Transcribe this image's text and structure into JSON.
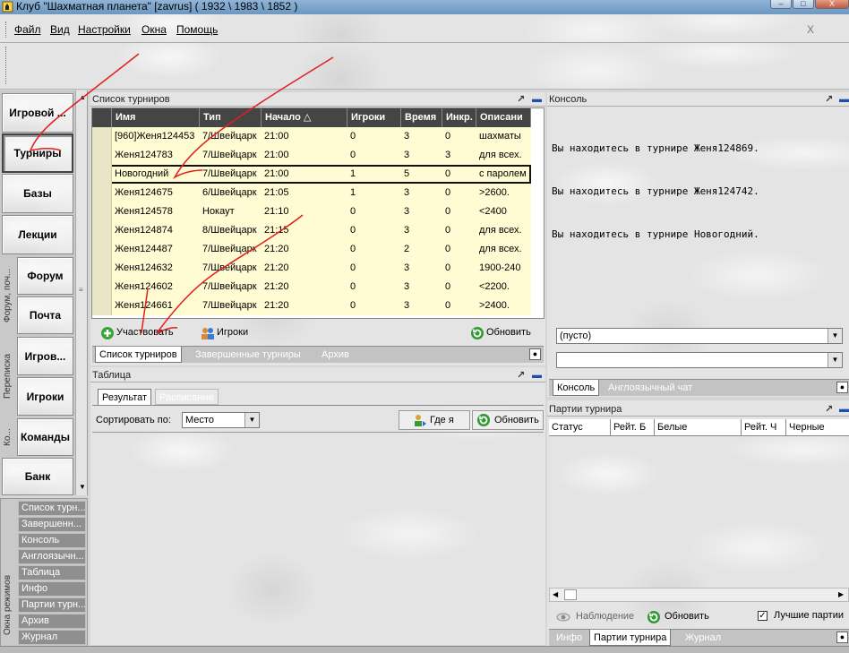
{
  "window": {
    "title": "Клуб \"Шахматная планета\" [zavrus]  ( 1932 \\ 1983 \\ 1852 )",
    "min": "–",
    "max": "□",
    "close": "X"
  },
  "menu": {
    "items": [
      "Файл",
      "Вид",
      "Настройки",
      "Окна",
      "Помощь"
    ],
    "close": "X"
  },
  "nav": {
    "buttons": [
      "Игровой ...",
      "Турниры",
      "Базы",
      "Лекции",
      "Форум",
      "Почта",
      "Игров...",
      "Игроки",
      "Команды",
      "Банк"
    ],
    "groups": [
      "Форум, поч...",
      "Переписка",
      "Ко..."
    ],
    "active": "Турниры"
  },
  "modes": {
    "title": "Окна режимов",
    "items": [
      "Список турн...",
      "Завершенн...",
      "Консоль",
      "Англоязычн...",
      "Таблица",
      "Инфо",
      "Партии турн...",
      "Архив",
      "Журнал"
    ]
  },
  "tournaments": {
    "title": "Список турниров",
    "columns": [
      "Имя",
      "Тип",
      "Начало",
      "Игроки",
      "Время",
      "Инкр.",
      "Описани"
    ],
    "sort_mark": "△",
    "rows": [
      [
        "[960]Женя124453",
        "7/Швейцарк",
        "21:00",
        "0",
        "3",
        "0",
        "шахматы"
      ],
      [
        "Женя124783",
        "7/Швейцарк",
        "21:00",
        "0",
        "3",
        "3",
        "для всех."
      ],
      [
        "Новогодний",
        "7/Швейцарк",
        "21:00",
        "1",
        "5",
        "0",
        "с паролем"
      ],
      [
        "Женя124675",
        "6/Швейцарк",
        "21:05",
        "1",
        "3",
        "0",
        ">2600."
      ],
      [
        "Женя124578",
        "Нокаут",
        "21:10",
        "0",
        "3",
        "0",
        "<2400"
      ],
      [
        "Женя124874",
        "8/Швейцарк",
        "21:15",
        "0",
        "3",
        "0",
        "для всех."
      ],
      [
        "Женя124487",
        "7/Швейцарк",
        "21:20",
        "0",
        "2",
        "0",
        "для всех."
      ],
      [
        "Женя124632",
        "7/Швейцарк",
        "21:20",
        "0",
        "3",
        "0",
        "1900-240"
      ],
      [
        "Женя124602",
        "7/Швейцарк",
        "21:20",
        "0",
        "3",
        "0",
        "<2200."
      ],
      [
        "Женя124661",
        "7/Швейцарк",
        "21:20",
        "0",
        "3",
        "0",
        ">2400."
      ]
    ],
    "selected_index": 2,
    "join_label": "Участвовать",
    "players_label": "Игроки",
    "refresh_label": "Обновить",
    "tabs": [
      "Список турниров",
      "Завершенные турниры",
      "Архив"
    ]
  },
  "table_panel": {
    "title": "Таблица",
    "subtabs": [
      "Результат",
      "Расписание"
    ],
    "sort_label": "Сортировать по:",
    "sort_value": "Место",
    "where_label": "Где я",
    "refresh_label": "Обновить"
  },
  "console": {
    "title": "Консоль",
    "lines": [
      "Вы находитесь в турнире Женя124869.",
      "Вы находитесь в турнире Женя124742.",
      "Вы находитесь в турнире Новогодний."
    ],
    "select1": "(пусто)",
    "select2": "",
    "tabs": [
      "Консоль",
      "Англоязычный чат"
    ]
  },
  "games": {
    "title": "Партии турнира",
    "columns": [
      "Статус",
      "Рейт. Б",
      "Белые",
      "Рейт. Ч",
      "Черные"
    ],
    "watch_label": "Наблюдение",
    "refresh_label": "Обновить",
    "best_label": "Лучшие партии",
    "best_checked": "✓",
    "tabs": [
      "Инфо",
      "Партии турнира",
      "Журнал"
    ]
  },
  "colors": {
    "row_bg": "#fffbd3",
    "header_bg": "#454545",
    "annotation": "#e0201c"
  }
}
